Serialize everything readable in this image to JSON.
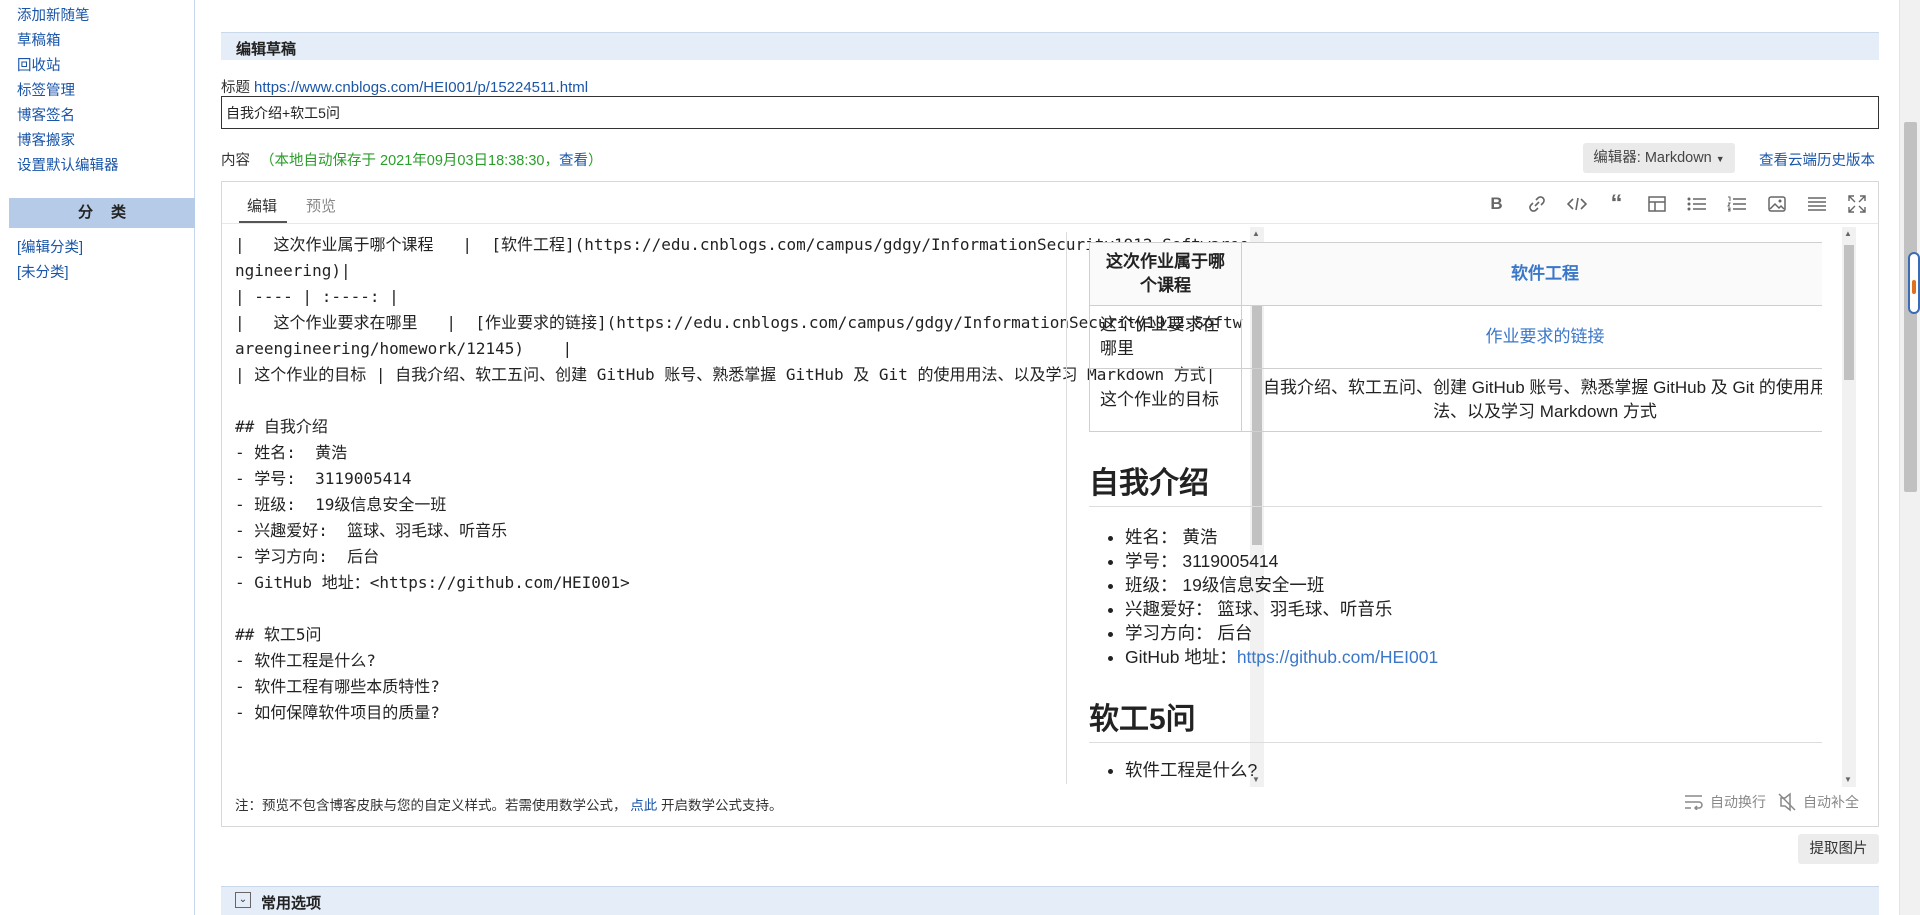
{
  "sidebar": {
    "links": [
      "添加新随笔",
      "草稿箱",
      "回收站",
      "标签管理",
      "博客签名",
      "博客搬家",
      "设置默认编辑器"
    ],
    "category_header": "分类",
    "category_links": [
      "[编辑分类]",
      "[未分类]"
    ]
  },
  "draft_header": "编辑草稿",
  "title_label": "标题",
  "title_url": "https://www.cnblogs.com/HEI001/p/15224511.html",
  "title_value": "自我介绍+软工5问",
  "content_label": "内容",
  "autosave_prefix": "（本地自动保存于 2021年09月03日18:38:30，",
  "autosave_view": "查看",
  "autosave_suffix": "）",
  "editor_select": "编辑器: Markdown",
  "history_link": "查看云端历史版本",
  "tabs": {
    "edit": "编辑",
    "preview": "预览"
  },
  "toolbar_icons": [
    "bold-icon",
    "link-icon",
    "code-icon",
    "quote-icon",
    "table-icon",
    "bullet-list-icon",
    "numbered-list-icon",
    "image-icon",
    "align-icon",
    "fullscreen-icon"
  ],
  "source_lines": [
    "|   这次作业属于哪个课程   |  [软件工程](https://edu.cnblogs.com/campus/gdgy/InformationSecurity1912-Softwareengineering)|",
    "| ---- | :----: |",
    "|   这个作业要求在哪里   |  [作业要求的链接](https://edu.cnblogs.com/campus/gdgy/InformationSecurity1912-Softwareengineering/homework/12145)    |",
    "| 这个作业的目标 | 自我介绍、软工五问、创建 GitHub 账号、熟悉掌握 GitHub 及 Git 的使用用法、以及学习 Markdown 方式|",
    "",
    "## 自我介绍",
    "- 姓名:  黄浩",
    "- 学号:  3119005414",
    "- 班级:  19级信息安全一班",
    "- 兴趣爱好:  篮球、羽毛球、听音乐",
    "- 学习方向:  后台",
    "- GitHub 地址：<https://github.com/HEI001>",
    "",
    "## 软工5问",
    "- 软件工程是什么?",
    "- 软件工程有哪些本质特性?",
    "- 如何保障软件项目的质量?"
  ],
  "preview": {
    "table": [
      {
        "c1": "这次作业属于哪个课程",
        "c2": "软件工程",
        "link": true
      },
      {
        "c1": "这个作业要求在哪里",
        "c2": "作业要求的链接",
        "link": true
      },
      {
        "c1": "这个作业的目标",
        "c2": "自我介绍、软工五问、创建 GitHub 账号、熟悉掌握 GitHub 及 Git 的使用用法、以及学习 Markdown 方式",
        "link": false
      }
    ],
    "h_intro": "自我介绍",
    "intro_items": [
      "姓名： 黄浩",
      "学号： 3119005414",
      "班级： 19级信息安全一班",
      "兴趣爱好： 篮球、羽毛球、听音乐",
      "学习方向： 后台"
    ],
    "github_label": "GitHub 地址：",
    "github_url": "https://github.com/HEI001",
    "h_five": "软工5问",
    "five_items": [
      "软件工程是什么?"
    ]
  },
  "note_prefix": "注：预览不包含博客皮肤与您的自定义样式。若需使用数学公式，",
  "note_link": "点此",
  "note_suffix": "开启数学公式支持。",
  "auto_wrap": "自动换行",
  "auto_complete": "自动补全",
  "extract_button": "提取图片",
  "options_header": "常用选项"
}
